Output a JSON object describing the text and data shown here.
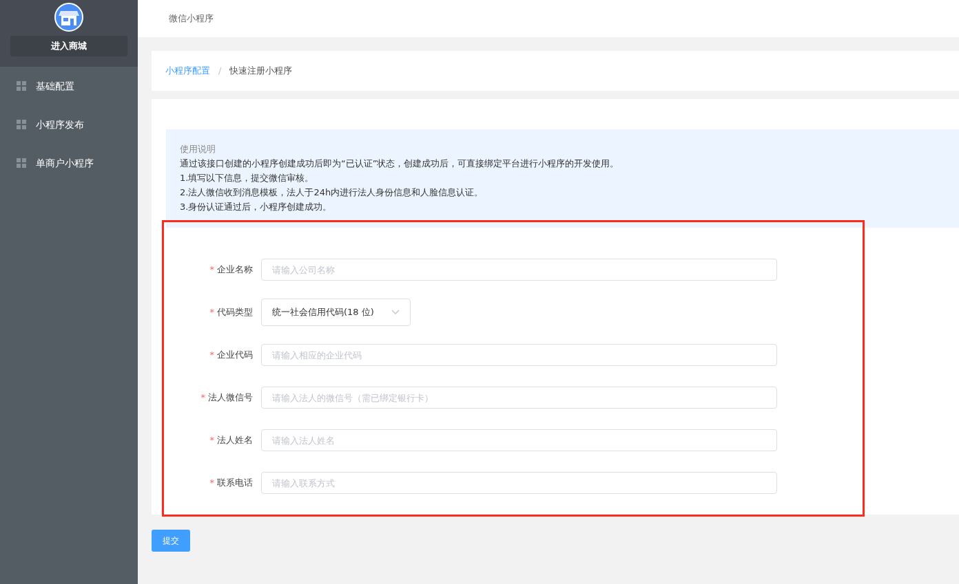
{
  "sidebar": {
    "shop_button": "进入商城",
    "items": [
      {
        "label": "基础配置",
        "selected": false
      },
      {
        "label": "小程序发布",
        "selected": false
      },
      {
        "label": "单商户小程序",
        "selected": false
      }
    ]
  },
  "header": {
    "title": "微信小程序"
  },
  "breadcrumb": {
    "separator": "/",
    "items": [
      {
        "label": "小程序配置",
        "link": true
      },
      {
        "label": "快速注册小程序",
        "link": false
      }
    ]
  },
  "notice": {
    "title": "使用说明",
    "lines": [
      "通过该接口创建的小程序创建成功后即为“已认证”状态，创建成功后，可直接绑定平台进行小程序的开发使用。",
      "1.填写以下信息，提交微信审核。",
      "2.法人微信收到消息模板，法人于24h内进行法人身份信息和人脸信息认证。",
      "3.身份认证通过后，小程序创建成功。"
    ]
  },
  "form": {
    "highlighted": true,
    "fields": [
      {
        "kind": "input",
        "label": "企业名称",
        "required_mark": "*",
        "placeholder": "请输入公司名称"
      },
      {
        "kind": "select",
        "label": "代码类型",
        "required_mark": "*",
        "value": "统一社会信用代码(18 位)"
      },
      {
        "kind": "input",
        "label": "企业代码",
        "required_mark": "*",
        "placeholder": "请输入相应的企业代码"
      },
      {
        "kind": "input",
        "label": "法人微信号",
        "required_mark": "*",
        "placeholder": "请输入法人的微信号（需已绑定银行卡）"
      },
      {
        "kind": "input",
        "label": "法人姓名",
        "required_mark": "*",
        "placeholder": "请输入法人姓名"
      },
      {
        "kind": "input",
        "label": "联系电话",
        "required_mark": "*",
        "placeholder": "请输入联系方式"
      }
    ]
  },
  "submit_button": "提交"
}
